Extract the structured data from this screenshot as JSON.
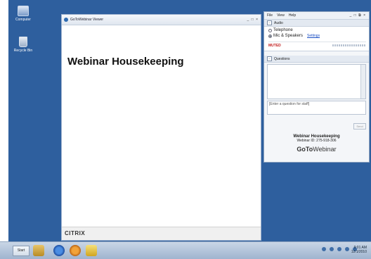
{
  "desktop": {
    "icons": [
      {
        "label": "Computer"
      },
      {
        "label": "Recycle Bin"
      }
    ]
  },
  "viewer": {
    "title": "GoToWebinar Viewer",
    "controls": "_ □ ×",
    "slide_title": "Webinar Housekeeping",
    "footer_brand": "CITRIX"
  },
  "control_panel": {
    "menu": [
      "File",
      "View",
      "Help"
    ],
    "window_controls": "_ □ ⧉ ×",
    "audio": {
      "section_label": "Audio",
      "options": [
        "Telephone",
        "Mic & Speakers"
      ],
      "selected": "Mic & Speakers",
      "settings_link": "Settings",
      "muted_label": "MUTED"
    },
    "questions": {
      "section_label": "Questions",
      "input_placeholder": "[Enter a question for staff]",
      "send_label": "Send"
    },
    "info": {
      "webinar_title": "Webinar Housekeeping",
      "webinar_id": "Webinar ID: 275-918-306",
      "brand_prefix": "GoTo",
      "brand_suffix": "Webinar"
    }
  },
  "taskbar": {
    "start_label": "Start",
    "clock_time": "9:01 AM",
    "clock_date": "12/1/2010"
  }
}
